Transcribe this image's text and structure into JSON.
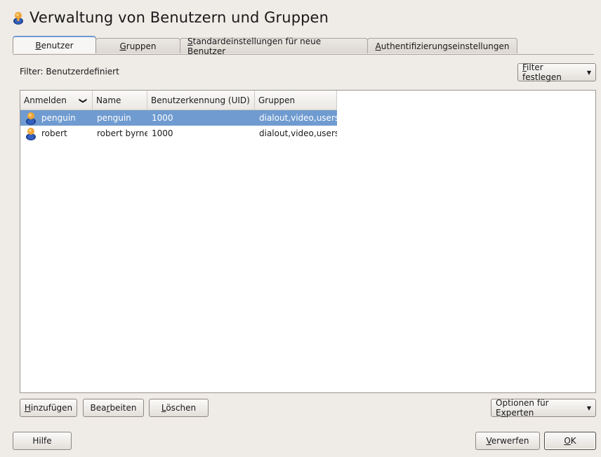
{
  "window": {
    "title": "Verwaltung von Benutzern und Gruppen",
    "title_icon": "user-icon"
  },
  "tabs": [
    {
      "label_pre": "",
      "label_ul": "B",
      "label_post": "enutzer",
      "active": true
    },
    {
      "label_pre": "",
      "label_ul": "G",
      "label_post": "ruppen",
      "active": false
    },
    {
      "label_pre": "",
      "label_ul": "S",
      "label_post": "tandardeinstellungen für neue Benutzer",
      "active": false
    },
    {
      "label_pre": "",
      "label_ul": "A",
      "label_post": "uthentifizierungseinstellungen",
      "active": false
    }
  ],
  "filter": {
    "label": "Filter: Benutzerdefiniert",
    "button_ul": "F",
    "button_post": "ilter festlegen"
  },
  "table": {
    "columns": [
      "Anmelden",
      "Name",
      "Benutzerkennung (UID)",
      "Gruppen"
    ],
    "sort_indicator": "❯",
    "rows": [
      {
        "login": "penguin",
        "name": "penguin",
        "uid": "1000",
        "groups": "dialout,video,users",
        "selected": true
      },
      {
        "login": "robert",
        "name": "robert byrne",
        "uid": "1000",
        "groups": "dialout,video,users",
        "selected": false
      }
    ]
  },
  "actions": {
    "add_ul": "H",
    "add_post": "inzufügen",
    "edit_pre": "Bea",
    "edit_ul": "r",
    "edit_post": "beiten",
    "delete_ul": "L",
    "delete_post": "öschen",
    "expert_pre": "Optionen für E",
    "expert_ul": "x",
    "expert_post": "perten"
  },
  "footer": {
    "help": "Hilfe",
    "cancel_ul": "V",
    "cancel_post": "erwerfen",
    "ok_ul": "O",
    "ok_post": "K"
  },
  "colors": {
    "selection": "#6f9bd0",
    "background": "#efebe7",
    "active_tab_accent": "#6f9bd0"
  }
}
